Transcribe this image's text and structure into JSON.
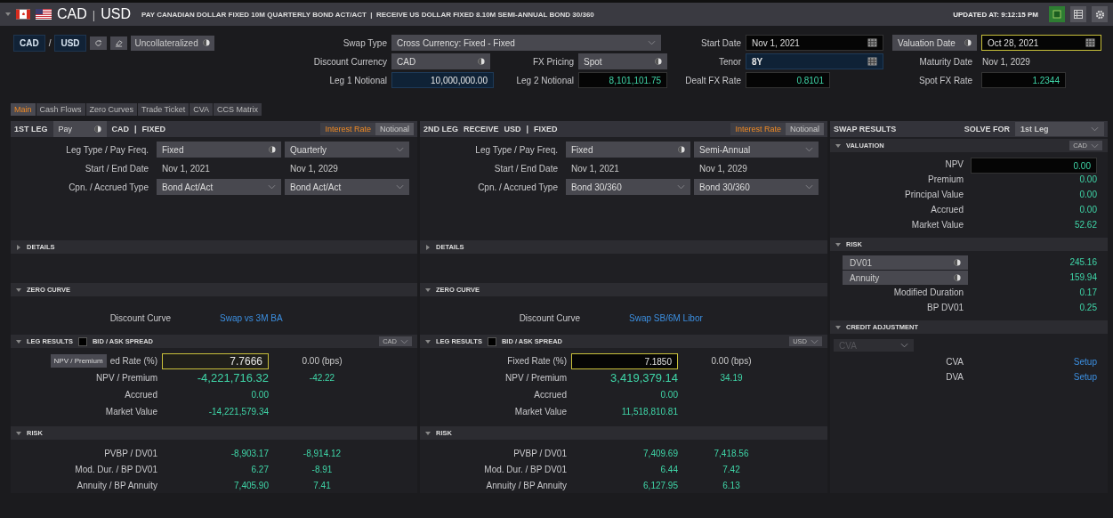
{
  "header": {
    "base": "CAD",
    "separator": "|",
    "quote": "USD",
    "description": "PAY CANADIAN DOLLAR FIXED 10M QUARTERLY BOND ACT/ACT  |  RECEIVE US DOLLAR FIXED 8.10M SEMI-ANNUAL BOND 30/360",
    "updated": "UPDATED AT: 9:12:15 PM"
  },
  "toolbar": {
    "base": "CAD",
    "separator": "/",
    "quote": "USD",
    "collateral": "Uncollateralized"
  },
  "form": {
    "swap_type": {
      "label": "Swap Type",
      "value": "Cross Currency: Fixed - Fixed"
    },
    "discount_currency": {
      "label": "Discount Currency",
      "value": "CAD"
    },
    "fx_pricing": {
      "label": "FX Pricing",
      "value": "Spot"
    },
    "leg1_notional": {
      "label": "Leg 1 Notional",
      "value": "10,000,000.00"
    },
    "leg2_notional": {
      "label": "Leg 2 Notional",
      "value": "8,101,101.75"
    },
    "start_date": {
      "label": "Start Date",
      "value": "Nov 1, 2021"
    },
    "tenor": {
      "label": "Tenor",
      "value": "8Y"
    },
    "dealt_fx_rate": {
      "label": "Dealt FX Rate",
      "value": "0.8101"
    },
    "valuation_date": {
      "label": "Valuation Date",
      "value": "Oct 28, 2021"
    },
    "maturity_date": {
      "label": "Maturity Date",
      "value": "Nov 1, 2029"
    },
    "spot_fx_rate": {
      "label": "Spot FX Rate",
      "value": "1.2344"
    }
  },
  "tabs": [
    {
      "label": "Main",
      "selected": true
    },
    {
      "label": "Cash Flows",
      "selected": false
    },
    {
      "label": "Zero Curves",
      "selected": false
    },
    {
      "label": "Trade Ticket",
      "selected": false
    },
    {
      "label": "CVA",
      "selected": false
    },
    {
      "label": "CCS Matrix",
      "selected": false
    }
  ],
  "legs": [
    {
      "title": "1ST LEG",
      "direction": {
        "kind": "toggle",
        "text": "Pay"
      },
      "currency": "CAD",
      "separator": "|",
      "type": "FIXED",
      "modes": [
        {
          "label": "Interest Rate",
          "selected": true
        },
        {
          "label": "Notional",
          "selected": false
        }
      ],
      "terms": [
        {
          "label": "Leg Type / Pay Freq.",
          "values": [
            {
              "kind": "toggle",
              "text": "Fixed"
            },
            {
              "kind": "select",
              "text": "Quarterly"
            }
          ]
        },
        {
          "label": "Start / End Date",
          "values": [
            {
              "kind": "text",
              "text": "Nov 1, 2021"
            },
            {
              "kind": "text",
              "text": "Nov 1, 2029"
            }
          ]
        },
        {
          "label": "Cpn. / Accrued Type",
          "values": [
            {
              "kind": "select",
              "text": "Bond Act/Act"
            },
            {
              "kind": "select",
              "text": "Bond Act/Act"
            }
          ]
        }
      ],
      "details": {
        "title": "DETAILS",
        "expanded": false
      },
      "zero_curve": {
        "title": "ZERO CURVE",
        "expanded": true,
        "label": "Discount Curve",
        "link": "Swap vs 3M BA"
      },
      "leg_results": {
        "title": "LEG RESULTS",
        "expanded": true,
        "spread": {
          "label": "BID / ASK SPREAD",
          "checked": false
        },
        "currency": "CAD",
        "tooltip": "NPV / Premium",
        "rows": [
          {
            "kind": "input",
            "label": "ed Rate (%)",
            "value": "7.7666",
            "extra": "0.00 (bps)"
          },
          {
            "kind": "large",
            "label": "NPV / Premium",
            "value": "-4,221,716.32",
            "extra": "-42.22"
          },
          {
            "kind": "plain",
            "label": "Accrued",
            "value": "0.00"
          },
          {
            "kind": "plain",
            "label": "Market Value",
            "value": "-14,221,579.34"
          }
        ]
      },
      "risk": {
        "title": "RISK",
        "expanded": true,
        "rows": [
          {
            "label": "PVBP / DV01",
            "value": "-8,903.17",
            "extra": "-8,914.12"
          },
          {
            "label": "Mod. Dur. / BP DV01",
            "value": "6.27",
            "extra": "-8.91"
          },
          {
            "label": "Annuity / BP Annuity",
            "value": "7,405.90",
            "extra": "7.41"
          }
        ]
      }
    },
    {
      "title": "2ND LEG",
      "direction": {
        "kind": "text",
        "text": "RECEIVE"
      },
      "currency": "USD",
      "separator": "|",
      "type": "FIXED",
      "modes": [
        {
          "label": "Interest Rate",
          "selected": true
        },
        {
          "label": "Notional",
          "selected": false
        }
      ],
      "terms": [
        {
          "label": "Leg Type / Pay Freq.",
          "values": [
            {
              "kind": "toggle",
              "text": "Fixed"
            },
            {
              "kind": "select",
              "text": "Semi-Annual"
            }
          ]
        },
        {
          "label": "Start / End Date",
          "values": [
            {
              "kind": "text",
              "text": "Nov 1, 2021"
            },
            {
              "kind": "text",
              "text": "Nov 1, 2029"
            }
          ]
        },
        {
          "label": "Cpn. / Accrued Type",
          "values": [
            {
              "kind": "select",
              "text": "Bond 30/360"
            },
            {
              "kind": "select",
              "text": "Bond 30/360"
            }
          ]
        }
      ],
      "details": {
        "title": "DETAILS",
        "expanded": false
      },
      "zero_curve": {
        "title": "ZERO CURVE",
        "expanded": true,
        "label": "Discount Curve",
        "link": "Swap SB/6M Libor"
      },
      "leg_results": {
        "title": "LEG RESULTS",
        "expanded": true,
        "spread": {
          "label": "BID / ASK SPREAD",
          "checked": false
        },
        "currency": "USD",
        "rows": [
          {
            "kind": "input",
            "label": "Fixed Rate (%)",
            "value": "7.1850",
            "extra": "0.00 (bps)"
          },
          {
            "kind": "large",
            "label": "NPV / Premium",
            "value": "3,419,379.14",
            "extra": "34.19"
          },
          {
            "kind": "plain",
            "label": "Accrued",
            "value": "0.00"
          },
          {
            "kind": "plain",
            "label": "Market Value",
            "value": "11,518,810.81"
          }
        ]
      },
      "risk": {
        "title": "RISK",
        "expanded": true,
        "rows": [
          {
            "label": "PVBP / DV01",
            "value": "7,409.69",
            "extra": "7,418.56"
          },
          {
            "label": "Mod. Dur. / BP DV01",
            "value": "6.44",
            "extra": "7.42"
          },
          {
            "label": "Annuity / BP Annuity",
            "value": "6,127.95",
            "extra": "6.13"
          }
        ]
      }
    }
  ],
  "results": {
    "title": "SWAP RESULTS",
    "solve_label": "SOLVE FOR",
    "solve_value": "1st Leg",
    "valuation": {
      "title": "VALUATION",
      "expanded": true,
      "currency": "CAD",
      "rows": [
        {
          "kind": "input",
          "label": "NPV",
          "value": "0.00"
        },
        {
          "kind": "plain",
          "label": "Premium",
          "value": "0.00"
        },
        {
          "kind": "plain",
          "label": "Principal Value",
          "value": "0.00"
        },
        {
          "kind": "plain",
          "label": "Accrued",
          "value": "0.00"
        },
        {
          "kind": "plain",
          "label": "Market Value",
          "value": "52.62"
        }
      ]
    },
    "risk": {
      "title": "RISK",
      "expanded": true,
      "rows": [
        {
          "kind": "toggle",
          "label": "DV01",
          "value": "245.16"
        },
        {
          "kind": "toggle",
          "label": "Annuity",
          "value": "159.94"
        },
        {
          "kind": "plain",
          "label": "Modified Duration",
          "value": "0.17"
        },
        {
          "kind": "plain",
          "label": "BP DV01",
          "value": "0.25"
        }
      ]
    },
    "credit": {
      "title": "CREDIT ADJUSTMENT",
      "expanded": true,
      "select": {
        "text": "CVA",
        "disabled": true
      },
      "rows": [
        {
          "label": "CVA",
          "link": "Setup"
        },
        {
          "label": "DVA",
          "link": "Setup"
        }
      ]
    }
  }
}
